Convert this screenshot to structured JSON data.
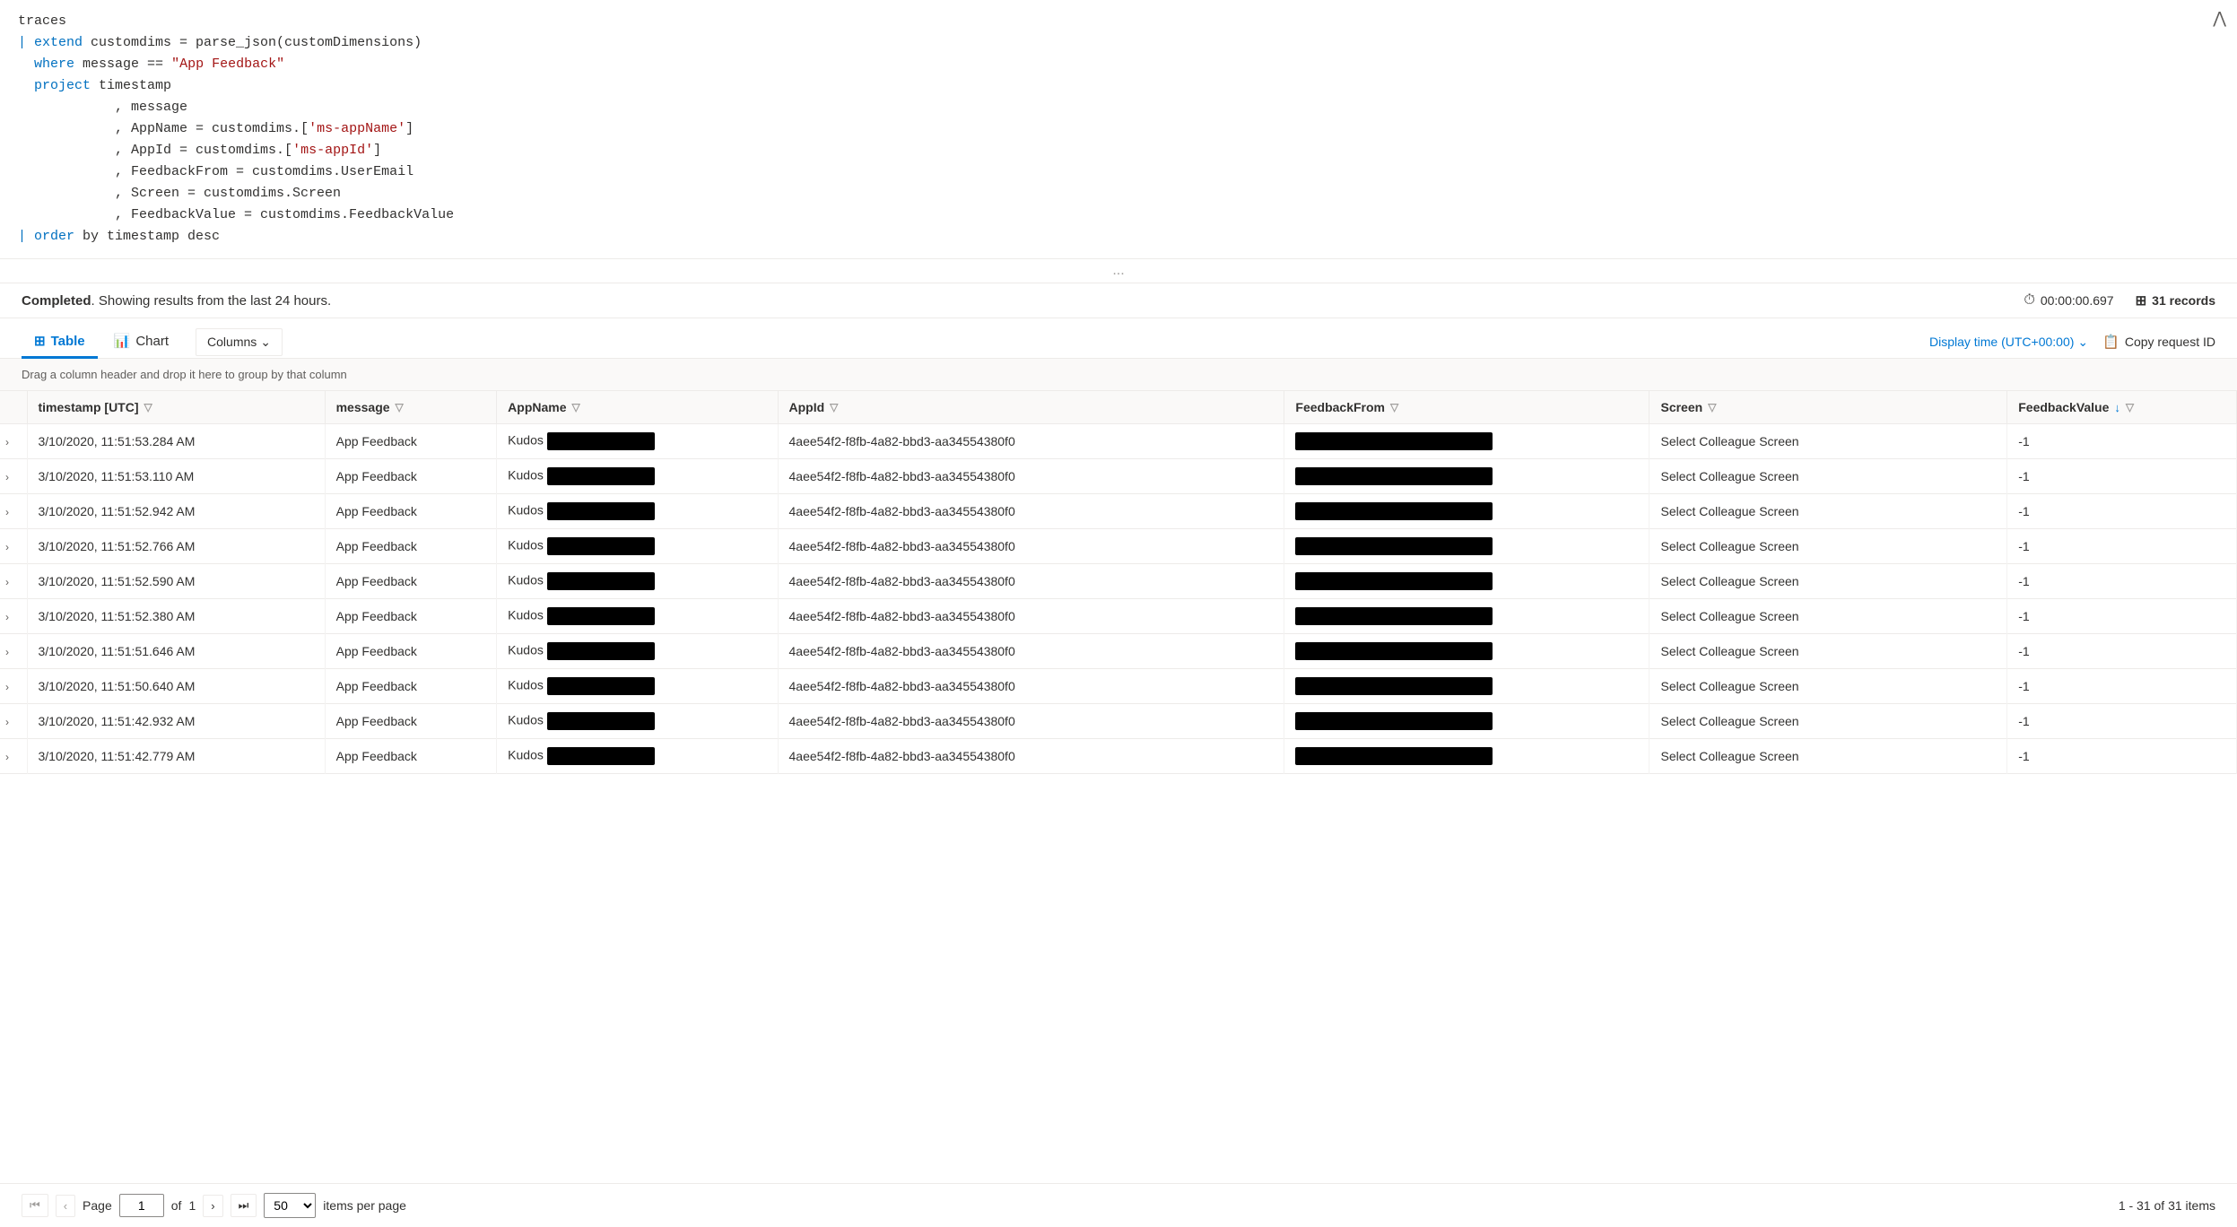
{
  "editor": {
    "lines": [
      {
        "indent": 0,
        "content": [
          {
            "type": "default",
            "text": "traces"
          }
        ]
      },
      {
        "indent": 0,
        "content": [
          {
            "type": "pipe",
            "text": "| "
          },
          {
            "type": "blue",
            "text": "extend"
          },
          {
            "type": "default",
            "text": " customdims = parse_json(customDimensions)"
          }
        ]
      },
      {
        "indent": 0,
        "content": [
          {
            "type": "pipe",
            "text": "  "
          },
          {
            "type": "blue",
            "text": "where"
          },
          {
            "type": "default",
            "text": " mes"
          },
          {
            "type": "cursor",
            "text": "s"
          },
          {
            "type": "default",
            "text": "age == "
          },
          {
            "type": "string",
            "text": "\"App Feedback\""
          }
        ]
      },
      {
        "indent": 0,
        "content": [
          {
            "type": "pipe",
            "text": "  "
          },
          {
            "type": "blue",
            "text": "project"
          },
          {
            "type": "default",
            "text": " timestamp"
          }
        ]
      },
      {
        "indent": 4,
        "content": [
          {
            "type": "default",
            "text": ", message"
          }
        ]
      },
      {
        "indent": 4,
        "content": [
          {
            "type": "default",
            "text": ", AppName = customdims.["
          },
          {
            "type": "string",
            "text": "'ms-appName'"
          },
          {
            "type": "default",
            "text": "]"
          }
        ]
      },
      {
        "indent": 4,
        "content": [
          {
            "type": "default",
            "text": ", AppId = customdims.["
          },
          {
            "type": "string",
            "text": "'ms-appId'"
          },
          {
            "type": "default",
            "text": "]"
          }
        ]
      },
      {
        "indent": 4,
        "content": [
          {
            "type": "default",
            "text": ", FeedbackFrom = customdims.UserEmail"
          }
        ]
      },
      {
        "indent": 4,
        "content": [
          {
            "type": "default",
            "text": ", Screen = customdims.Screen"
          }
        ]
      },
      {
        "indent": 4,
        "content": [
          {
            "type": "default",
            "text": ", FeedbackValue = customdims.FeedbackValue"
          }
        ]
      },
      {
        "indent": 0,
        "content": [
          {
            "type": "pipe",
            "text": "| "
          },
          {
            "type": "blue",
            "text": "order"
          },
          {
            "type": "default",
            "text": " by timestamp desc"
          }
        ]
      }
    ]
  },
  "status": {
    "completed_text": "Completed",
    "showing_text": ". Showing results from the last 24 hours.",
    "time_label": "00:00:00.697",
    "records_label": "31 records"
  },
  "toolbar": {
    "tab_table": "Table",
    "tab_chart": "Chart",
    "columns_btn": "Columns",
    "display_time": "Display time (UTC+00:00)",
    "copy_request": "Copy request ID"
  },
  "drag_hint": "Drag a column header and drop it here to group by that column",
  "columns": [
    {
      "id": "expand",
      "label": ""
    },
    {
      "id": "timestamp",
      "label": "timestamp [UTC]",
      "filter": true,
      "sort": false
    },
    {
      "id": "message",
      "label": "message",
      "filter": true,
      "sort": false
    },
    {
      "id": "appname",
      "label": "AppName",
      "filter": true,
      "sort": false
    },
    {
      "id": "appid",
      "label": "AppId",
      "filter": true,
      "sort": false
    },
    {
      "id": "feedbackfrom",
      "label": "FeedbackFrom",
      "filter": true,
      "sort": false
    },
    {
      "id": "screen",
      "label": "Screen",
      "filter": true,
      "sort": false
    },
    {
      "id": "feedbackvalue",
      "label": "FeedbackValue",
      "filter": true,
      "sort": true
    }
  ],
  "rows": [
    {
      "timestamp": "3/10/2020, 11:51:53.284 AM",
      "message": "App Feedback",
      "appname": "Kudos",
      "appid": "4aee54f2-f8fb-4a82-bbd3-aa34554380f0",
      "feedbackfrom": "REDACTED",
      "screen": "Select Colleague Screen",
      "feedbackvalue": "-1"
    },
    {
      "timestamp": "3/10/2020, 11:51:53.110 AM",
      "message": "App Feedback",
      "appname": "Kudos",
      "appid": "4aee54f2-f8fb-4a82-bbd3-aa34554380f0",
      "feedbackfrom": "REDACTED",
      "screen": "Select Colleague Screen",
      "feedbackvalue": "-1"
    },
    {
      "timestamp": "3/10/2020, 11:51:52.942 AM",
      "message": "App Feedback",
      "appname": "Kudos",
      "appid": "4aee54f2-f8fb-4a82-bbd3-aa34554380f0",
      "feedbackfrom": "REDACTED",
      "screen": "Select Colleague Screen",
      "feedbackvalue": "-1"
    },
    {
      "timestamp": "3/10/2020, 11:51:52.766 AM",
      "message": "App Feedback",
      "appname": "Kudos",
      "appid": "4aee54f2-f8fb-4a82-bbd3-aa34554380f0",
      "feedbackfrom": "REDACTED",
      "screen": "Select Colleague Screen",
      "feedbackvalue": "-1"
    },
    {
      "timestamp": "3/10/2020, 11:51:52.590 AM",
      "message": "App Feedback",
      "appname": "Kudos",
      "appid": "4aee54f2-f8fb-4a82-bbd3-aa34554380f0",
      "feedbackfrom": "REDACTED",
      "screen": "Select Colleague Screen",
      "feedbackvalue": "-1"
    },
    {
      "timestamp": "3/10/2020, 11:51:52.380 AM",
      "message": "App Feedback",
      "appname": "Kudos",
      "appid": "4aee54f2-f8fb-4a82-bbd3-aa34554380f0",
      "feedbackfrom": "REDACTED",
      "screen": "Select Colleague Screen",
      "feedbackvalue": "-1"
    },
    {
      "timestamp": "3/10/2020, 11:51:51.646 AM",
      "message": "App Feedback",
      "appname": "Kudos",
      "appid": "4aee54f2-f8fb-4a82-bbd3-aa34554380f0",
      "feedbackfrom": "REDACTED",
      "screen": "Select Colleague Screen",
      "feedbackvalue": "-1"
    },
    {
      "timestamp": "3/10/2020, 11:51:50.640 AM",
      "message": "App Feedback",
      "appname": "Kudos",
      "appid": "4aee54f2-f8fb-4a82-bbd3-aa34554380f0",
      "feedbackfrom": "REDACTED",
      "screen": "Select Colleague Screen",
      "feedbackvalue": "-1"
    },
    {
      "timestamp": "3/10/2020, 11:51:42.932 AM",
      "message": "App Feedback",
      "appname": "Kudos",
      "appid": "4aee54f2-f8fb-4a82-bbd3-aa34554380f0",
      "feedbackfrom": "REDACTED",
      "screen": "Select Colleague Screen",
      "feedbackvalue": "-1"
    },
    {
      "timestamp": "3/10/2020, 11:51:42.779 AM",
      "message": "App Feedback",
      "appname": "Kudos",
      "appid": "4aee54f2-f8fb-4a82-bbd3-aa34554380f0",
      "feedbackfrom": "REDACTED",
      "screen": "Select Colleague Screen",
      "feedbackvalue": "-1"
    }
  ],
  "pagination": {
    "page_label": "Page",
    "page_value": "1",
    "of_label": "of",
    "of_value": "1",
    "per_page_value": "50",
    "items_label": "items per page",
    "range_label": "1 - 31 of 31 items"
  }
}
